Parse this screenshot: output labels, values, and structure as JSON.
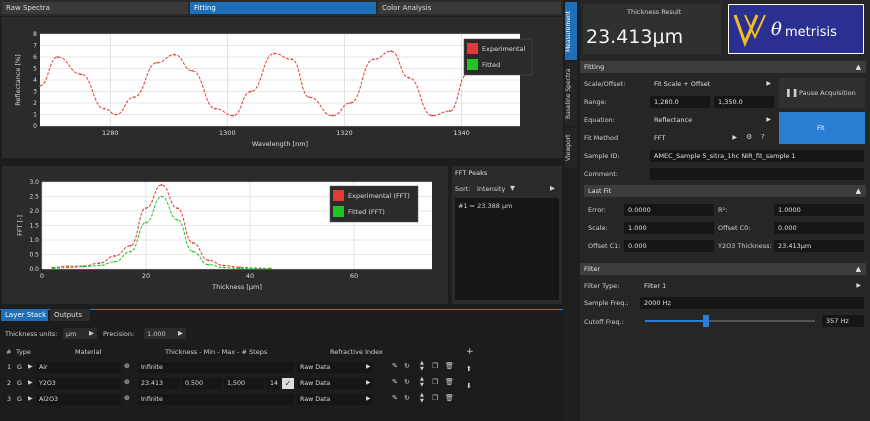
{
  "tabs": {
    "raw_spectra": "Raw Spectra",
    "fitting": "Fitting",
    "color_analysis": "Color Analysis"
  },
  "vertical_tabs": {
    "measurement": "Measurement",
    "baseline_spectra": "Baseline Spectra",
    "viewport": "Viewport"
  },
  "thickness_result": {
    "label": "Thickness Result",
    "value": "23.413μm"
  },
  "logo": {
    "text": "metrisis",
    "symbol": "θ"
  },
  "fitting": {
    "header": "Fitting",
    "scale_offset_label": "Scale/Offset:",
    "scale_offset_value": "Fit Scale + Offset",
    "range_label": "Range:",
    "range_min": "1,280.0",
    "range_max": "1,350.0",
    "equation_label": "Equation:",
    "equation_value": "Reflectance",
    "fit_method_label": "Fit Method",
    "fit_method_value": "FFT",
    "sample_id_label": "Sample ID:",
    "sample_id_value": "AMEC_Sample 5_sitra_1hc NIR_fit_sample 1",
    "comment_label": "Comment:",
    "comment_value": "",
    "pause_button": "Pause Acquisition",
    "fit_button": "Fit"
  },
  "last_fit": {
    "header": "Last Fit",
    "error_label": "Error:",
    "error_value": "0.0000",
    "r2_label": "R²:",
    "r2_value": "1.0000",
    "scale_label": "Scale:",
    "scale_value": "1.000",
    "offset_c0_label": "Offset C0:",
    "offset_c0_value": "0.000",
    "offset_c1_label": "Offset C1:",
    "offset_c1_value": "0.000",
    "y2o3_label": "Y2O3 Thickness:",
    "y2o3_value": "23.413μm"
  },
  "filter": {
    "header": "Filter",
    "type_label": "Filter Type:",
    "type_value": "Filter 1",
    "sample_freq_label": "Sample Freq.:",
    "sample_freq_value": "2000 Hz",
    "cutoff_label": "Cutoff Freq.:",
    "cutoff_value": "357 Hz",
    "cutoff_fraction": 0.36
  },
  "fft_peaks": {
    "title": "FFT Peaks",
    "sort_label": "Sort:",
    "sort_value": "Intensity",
    "peak": "#1 = 23.388 μm"
  },
  "bottom_tabs": {
    "layer_stack": "Layer Stack",
    "outputs": "Outputs"
  },
  "layer_controls": {
    "thickness_units_label": "Thickness units:",
    "thickness_units_value": "μm",
    "precision_label": "Precision:",
    "precision_value": "1.000"
  },
  "layer_table": {
    "headers": [
      "#",
      "Type",
      "Material",
      "Thickness - Min - Max - # Steps",
      "Refractive Index"
    ],
    "rows": [
      {
        "num": "1",
        "type": "G",
        "material": "Air",
        "thickness": "Infinite",
        "min": "",
        "max": "",
        "steps": "",
        "ri": "Raw Data"
      },
      {
        "num": "2",
        "type": "G",
        "material": "Y2O3",
        "thickness": "23.413",
        "min": "0.500",
        "max": "1,500",
        "steps": "14",
        "ri": "Raw Data"
      },
      {
        "num": "3",
        "type": "G",
        "material": "Al2O3",
        "thickness": "Infinite",
        "min": "",
        "max": "",
        "steps": "",
        "ri": "Raw Data"
      }
    ]
  },
  "colors": {
    "experimental": "#e53935",
    "fitted": "#22c322",
    "accent_blue": "#2a7fd4",
    "logo_bg": "#2b2f8f"
  },
  "chart_data": [
    {
      "type": "line",
      "title": "",
      "xlabel": "Wavelength [nm]",
      "ylabel": "Reflectance [%]",
      "xlim": [
        1268,
        1350
      ],
      "ylim": [
        0,
        8
      ],
      "xticks": [
        1280,
        1300,
        1320,
        1340
      ],
      "yticks": [
        0,
        1,
        2,
        3,
        4,
        5,
        6,
        7,
        8
      ],
      "series": [
        {
          "name": "Experimental",
          "x": [
            1268,
            1271,
            1275,
            1279,
            1281,
            1284,
            1288,
            1291,
            1294,
            1298,
            1301,
            1304,
            1308,
            1311,
            1314,
            1318,
            1321,
            1325,
            1328,
            1331,
            1335,
            1338,
            1341,
            1345
          ],
          "y": [
            3.5,
            6.0,
            4.5,
            1.5,
            1.0,
            2.5,
            5.5,
            6.2,
            4.8,
            1.5,
            0.9,
            3.0,
            6.3,
            5.8,
            2.5,
            0.9,
            2.0,
            5.8,
            6.5,
            4.2,
            0.9,
            1.3,
            4.5,
            6.2
          ]
        },
        {
          "name": "Fitted",
          "x": [],
          "y": []
        }
      ],
      "legend": "top-right",
      "grid": true
    },
    {
      "type": "line",
      "title": "",
      "xlabel": "Thickness [μm]",
      "ylabel": "FFT [-]",
      "xlim": [
        0,
        75
      ],
      "ylim": [
        0,
        3
      ],
      "xticks": [
        0,
        20,
        40,
        60
      ],
      "yticks": [
        0,
        0.5,
        1.0,
        1.5,
        2.0,
        2.5,
        3.0
      ],
      "series": [
        {
          "name": "Experimental (FFT)",
          "x": [
            2,
            5,
            8,
            11,
            14,
            17,
            20,
            23,
            26,
            29,
            32,
            35,
            38,
            41,
            44
          ],
          "y": [
            0.05,
            0.1,
            0.1,
            0.2,
            0.45,
            0.8,
            2.1,
            2.9,
            2.1,
            0.9,
            0.3,
            0.12,
            0.06,
            0.03,
            0.02
          ]
        },
        {
          "name": "Fitted (FFT)",
          "x": [
            2,
            5,
            8,
            11,
            14,
            17,
            20,
            23,
            26,
            29,
            32,
            35,
            38,
            41,
            44
          ],
          "y": [
            0.02,
            0.05,
            0.08,
            0.12,
            0.25,
            0.6,
            1.6,
            2.5,
            1.7,
            0.6,
            0.15,
            0.05,
            0.02,
            0.01,
            0.0
          ]
        }
      ],
      "legend": "top-right",
      "grid": true
    }
  ]
}
